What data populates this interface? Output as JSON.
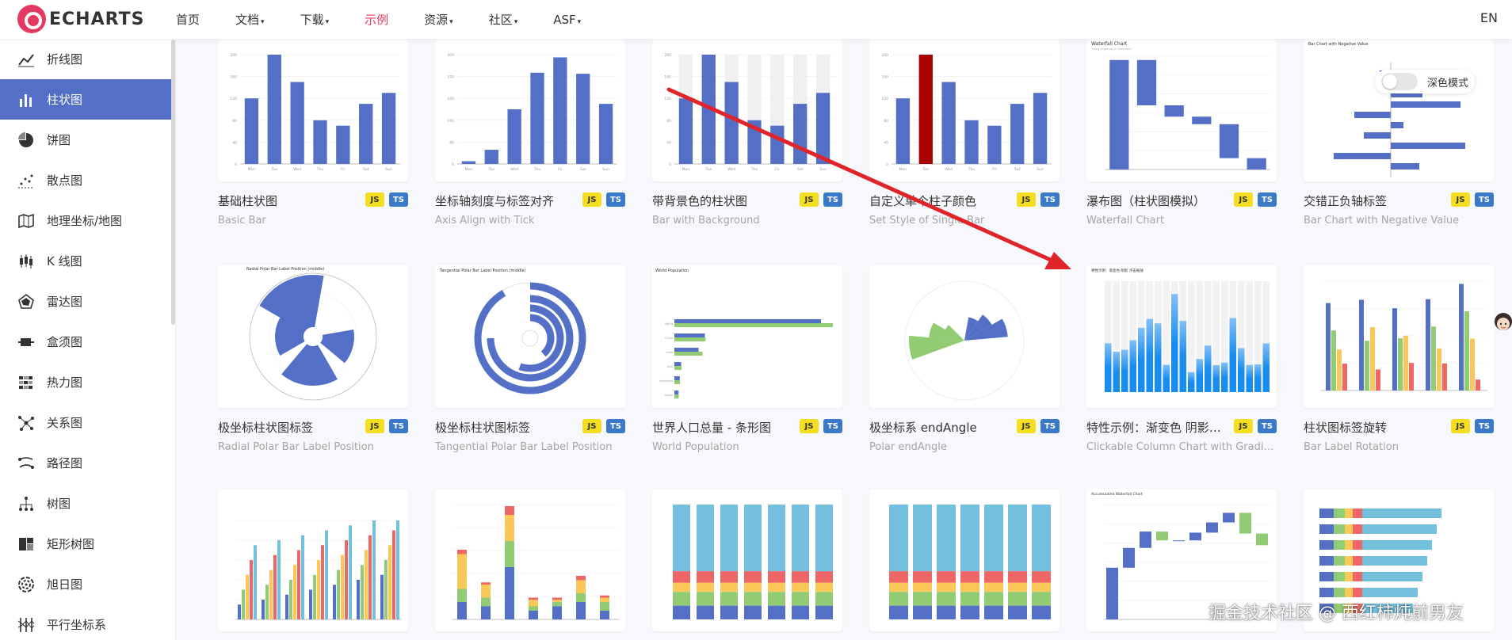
{
  "header": {
    "logo_text": "ECHARTS",
    "nav": [
      {
        "label": "首页",
        "active": false
      },
      {
        "label": "文档",
        "active": false,
        "dropdown": true
      },
      {
        "label": "下载",
        "active": false,
        "dropdown": true
      },
      {
        "label": "示例",
        "active": true
      },
      {
        "label": "资源",
        "active": false,
        "dropdown": true
      },
      {
        "label": "社区",
        "active": false,
        "dropdown": true
      },
      {
        "label": "ASF",
        "active": false,
        "dropdown": true
      }
    ],
    "lang": "EN",
    "accent": "#e43961"
  },
  "sidebar": {
    "items": [
      {
        "label": "折线图",
        "icon": "line-chart-icon"
      },
      {
        "label": "柱状图",
        "icon": "bar-chart-icon",
        "active": true
      },
      {
        "label": "饼图",
        "icon": "pie-chart-icon"
      },
      {
        "label": "散点图",
        "icon": "scatter-chart-icon"
      },
      {
        "label": "地理坐标/地图",
        "icon": "map-icon"
      },
      {
        "label": "K 线图",
        "icon": "candlestick-icon"
      },
      {
        "label": "雷达图",
        "icon": "radar-icon"
      },
      {
        "label": "盒须图",
        "icon": "boxplot-icon"
      },
      {
        "label": "热力图",
        "icon": "heatmap-icon"
      },
      {
        "label": "关系图",
        "icon": "graph-icon"
      },
      {
        "label": "路径图",
        "icon": "lines-icon"
      },
      {
        "label": "树图",
        "icon": "tree-icon"
      },
      {
        "label": "矩形树图",
        "icon": "treemap-icon"
      },
      {
        "label": "旭日图",
        "icon": "sunburst-icon"
      },
      {
        "label": "平行坐标系",
        "icon": "parallel-icon"
      }
    ],
    "active_color": "#5470c6"
  },
  "dark_mode": {
    "label": "深色模式",
    "on": false
  },
  "badges": {
    "js": "JS",
    "ts": "TS"
  },
  "cards": [
    {
      "title": "基础柱状图",
      "subtitle": "Basic Bar",
      "thumb": "basic"
    },
    {
      "title": "坐标轴刻度与标签对齐",
      "subtitle": "Axis Align with Tick",
      "thumb": "axisalign"
    },
    {
      "title": "带背景色的柱状图",
      "subtitle": "Bar with Background",
      "thumb": "background"
    },
    {
      "title": "自定义单个柱子颜色",
      "subtitle": "Set Style of Single Bar",
      "thumb": "single"
    },
    {
      "title": "瀑布图（柱状图模拟）",
      "subtitle": "Waterfall Chart",
      "thumb": "waterfall",
      "thumb_title": "Waterfall Chart",
      "thumb_sub": "Living Expenses in Shenzhen"
    },
    {
      "title": "交错正负轴标签",
      "subtitle": "Bar Chart with Negative Value",
      "thumb": "negative",
      "thumb_title": "Bar Chart with Negative Value"
    },
    {
      "title": "极坐标柱状图标签",
      "subtitle": "Radial Polar Bar Label Position",
      "thumb": "radial",
      "thumb_title": "Radial Polar Bar Label Position (middle)"
    },
    {
      "title": "极坐标柱状图标签",
      "subtitle": "Tangential Polar Bar Label Position",
      "thumb": "tangential",
      "thumb_title": "Tangential Polar Bar Label Position (middle)"
    },
    {
      "title": "世界人口总量 - 条形图",
      "subtitle": "World Population",
      "thumb": "population",
      "thumb_title": "World Population"
    },
    {
      "title": "极坐标系 endAngle",
      "subtitle": "Polar endAngle",
      "thumb": "endangle"
    },
    {
      "title": "特性示例：渐变色 阴影 点击缩放",
      "subtitle": "Clickable Column Chart with Gradient",
      "thumb": "gradient",
      "thumb_title": "特性示例：渐变色 阴影 点击缩放"
    },
    {
      "title": "柱状图标签旋转",
      "subtitle": "Bar Label Rotation",
      "thumb": "rotation"
    },
    {
      "title": "",
      "subtitle": "",
      "thumb": "mixed"
    },
    {
      "title": "",
      "subtitle": "",
      "thumb": "stackwide"
    },
    {
      "title": "",
      "subtitle": "",
      "thumb": "stack100a"
    },
    {
      "title": "",
      "subtitle": "",
      "thumb": "stack100b"
    },
    {
      "title": "",
      "subtitle": "",
      "thumb": "accwaterfall",
      "thumb_title": "Accumulated Waterfall Chart"
    },
    {
      "title": "",
      "subtitle": "",
      "thumb": "stackhbar"
    }
  ],
  "colors": {
    "series": [
      "#5470c6",
      "#91cc75",
      "#fac858",
      "#ee6666",
      "#73c0de",
      "#3ba272",
      "#fc8452",
      "#9a60b4"
    ],
    "highlight": "#a90000",
    "arrow": "#e0242a"
  },
  "watermark": "掘金技术社区 @ 西红柿炖前男友"
}
